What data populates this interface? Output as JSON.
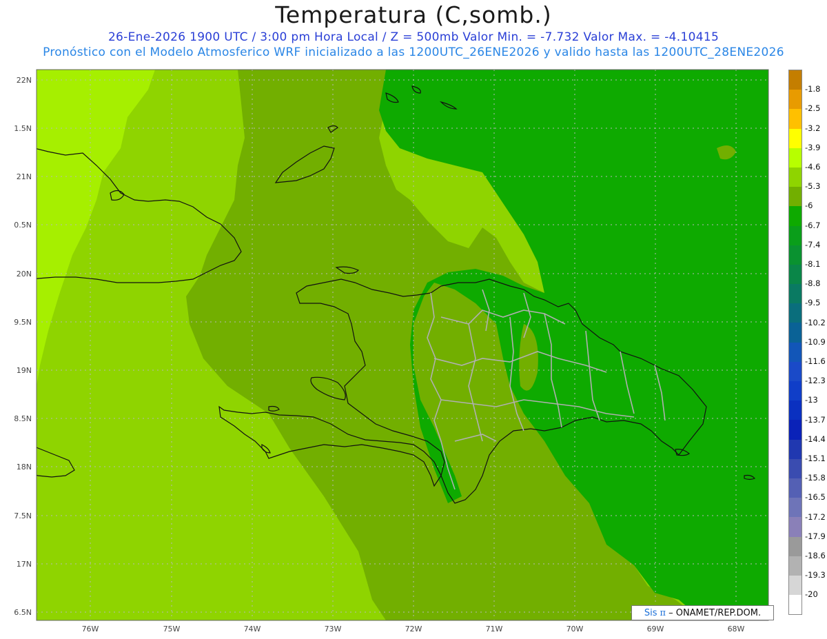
{
  "header": {
    "title": "Temperatura (C,somb.)",
    "subtitle_line1": "26-Ene-2026  1900 UTC / 3:00 pm Hora Local / Z = 500mb   Valor Min. = -7.732  Valor Max. = -4.10415",
    "subtitle_line2": "Pronóstico con el Modelo Atmosferico WRF inicializado a las 1200UTC_26ENE2026 y valido hasta las  1200UTC_28ENE2026"
  },
  "map": {
    "lat_labels": [
      "22N",
      "1.5N",
      "21N",
      "0.5N",
      "20N",
      "9.5N",
      "19N",
      "8.5N",
      "18N",
      "7.5N",
      "17N",
      "6.5N"
    ],
    "lon_labels": [
      "76W",
      "75W",
      "74W",
      "73W",
      "72W",
      "71W",
      "70W",
      "69W",
      "68W"
    ],
    "field_colors": {
      "band_minus_4_6": "#a6ef00",
      "band_minus_5_3": "#8fd400",
      "band_minus_6": "#72af00",
      "band_minus_6_7": "#0eaa00"
    }
  },
  "legend": {
    "labels": [
      "-1.8",
      "-2.5",
      "-3.2",
      "-3.9",
      "-4.6",
      "-5.3",
      "-6",
      "-6.7",
      "-7.4",
      "-8.1",
      "-8.8",
      "-9.5",
      "-10.2",
      "-10.9",
      "-11.6",
      "-12.3",
      "-13",
      "-13.7",
      "-14.4",
      "-15.1",
      "-15.8",
      "-16.5",
      "-17.2",
      "-17.9",
      "-18.6",
      "-19.3",
      "-20"
    ],
    "colors": [
      "#c47e00",
      "#e89b00",
      "#ffc000",
      "#ffff00",
      "#b7ff00",
      "#8fd400",
      "#72af00",
      "#0eaa00",
      "#0a9e1a",
      "#0a9230",
      "#0a8648",
      "#0a7a62",
      "#0a6e7c",
      "#0a6296",
      "#1256b8",
      "#1a4ac8",
      "#103ec8",
      "#0a30c0",
      "#0a22b8",
      "#2038b0",
      "#3a4cb0",
      "#5460b4",
      "#6e74b8",
      "#8a80b8",
      "#9a9a9a",
      "#b2b2b2",
      "#d6d6d6",
      "#ffffff"
    ]
  },
  "credit": {
    "sis": "Sis",
    "pi": "π",
    "org": "– ONAMET/REP.DOM."
  }
}
